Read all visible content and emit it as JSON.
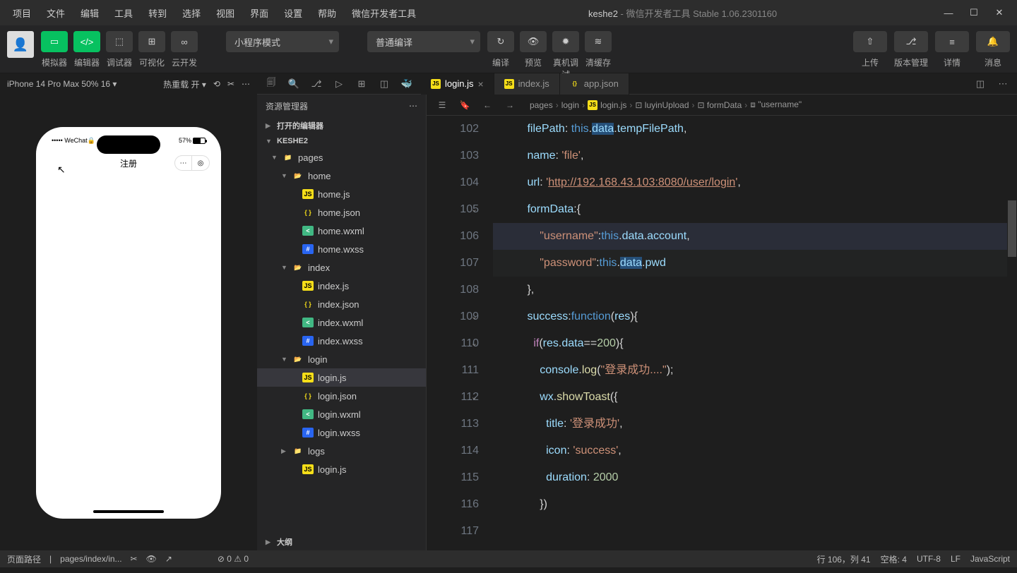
{
  "menu": [
    "项目",
    "文件",
    "编辑",
    "工具",
    "转到",
    "选择",
    "视图",
    "界面",
    "设置",
    "帮助",
    "微信开发者工具"
  ],
  "title": {
    "project": "keshe2",
    "suffix": " - 微信开发者工具 Stable 1.06.2301160"
  },
  "toolbar": {
    "labels": [
      "模拟器",
      "编辑器",
      "调试器",
      "可视化",
      "云开发"
    ],
    "mode": "小程序模式",
    "compile": "普通编译",
    "compile_labels": [
      "编译",
      "预览",
      "真机调试",
      "清缓存"
    ],
    "right": [
      "上传",
      "版本管理",
      "详情",
      "消息"
    ]
  },
  "simbar": {
    "device": "iPhone 14 Pro Max 50% 16 ▾",
    "reload": "热重载 开 ▾"
  },
  "phone": {
    "carrier": "••••• WeChat🔒",
    "batt": "57%",
    "title": "注册"
  },
  "explorer": {
    "title": "资源管理器",
    "sections": {
      "open": "打开的编辑器",
      "project": "KESHE2",
      "outline": "大纲"
    },
    "pages": "pages",
    "folders": {
      "home": "home",
      "index": "index",
      "login": "login",
      "logs": "logs"
    },
    "files": {
      "home": [
        "home.js",
        "home.json",
        "home.wxml",
        "home.wxss"
      ],
      "index": [
        "index.js",
        "index.json",
        "index.wxml",
        "index.wxss"
      ],
      "login": [
        "login.js",
        "login.json",
        "login.wxml",
        "login.wxss"
      ],
      "logs": [
        "login.js"
      ]
    }
  },
  "tabs": [
    {
      "name": "login.js",
      "active": true
    },
    {
      "name": "index.js"
    },
    {
      "name": "app.json"
    }
  ],
  "breadcrumbs": [
    "pages",
    "login",
    "login.js",
    "luyinUpload",
    "formData",
    "\"username\""
  ],
  "code": {
    "start": 102,
    "lines": [
      {
        "n": 102,
        "html": "          <span class='c-prop'>filePath</span><span class='c-pun'>:</span> <span class='c-this'>this</span><span class='c-pun'>.</span><span class='c-var sel'>data</span><span class='c-pun'>.</span><span class='c-var'>tempFilePath</span><span class='c-pun'>,</span>"
      },
      {
        "n": 103,
        "html": "          <span class='c-prop'>name</span><span class='c-pun'>:</span> <span class='c-str'>'file'</span><span class='c-pun'>,</span>"
      },
      {
        "n": 104,
        "html": "          <span class='c-prop'>url</span><span class='c-pun'>:</span> <span class='c-str'>'</span><span class='c-url'>http://192.168.43.103:8080/user/login</span><span class='c-str'>'</span><span class='c-pun'>,</span>"
      },
      {
        "n": 105,
        "fold": true,
        "html": "          <span class='c-prop'>formData</span><span class='c-pun'>:</span><span class='c-pun'>{</span>"
      },
      {
        "n": 106,
        "cur": true,
        "hl": true,
        "html": "              <span class='c-str'>\"username\"</span><span class='c-pun'>:</span><span class='c-this'>this</span><span class='c-pun'>.</span><span class='c-var'>data</span><span class='c-pun'>.</span><span class='c-var'>account</span><span class='c-pun'>,</span>"
      },
      {
        "n": 107,
        "hl": true,
        "html": "              <span class='c-str'>\"password\"</span><span class='c-pun'>:</span><span class='c-this'>this</span><span class='c-pun'>.</span><span class='c-var sel'>data</span><span class='c-pun'>.</span><span class='c-var'>pwd</span>"
      },
      {
        "n": 108,
        "html": "          <span class='c-pun'>},</span>"
      },
      {
        "n": 109,
        "fold": true,
        "html": "          <span class='c-prop'>success</span><span class='c-pun'>:</span><span class='c-this'>function</span><span class='c-pun'>(</span><span class='c-var'>res</span><span class='c-pun'>){</span>"
      },
      {
        "n": 110,
        "fold": true,
        "html": "            <span class='c-key'>if</span><span class='c-pun'>(</span><span class='c-var'>res</span><span class='c-pun'>.</span><span class='c-var'>data</span><span class='c-pun'>==</span><span class='c-num'>200</span><span class='c-pun'>){</span>"
      },
      {
        "n": 111,
        "html": "              <span class='c-var'>console</span><span class='c-pun'>.</span><span class='c-fn'>log</span><span class='c-pun'>(</span><span class='c-str'>\"登录成功....\"</span><span class='c-pun'>);</span>"
      },
      {
        "n": 112,
        "fold": true,
        "html": "              <span class='c-var'>wx</span><span class='c-pun'>.</span><span class='c-fn'>showToast</span><span class='c-pun'>({</span>"
      },
      {
        "n": 113,
        "html": "                <span class='c-prop'>title</span><span class='c-pun'>:</span> <span class='c-str'>'登录成功'</span><span class='c-pun'>,</span>"
      },
      {
        "n": 114,
        "html": "                <span class='c-prop'>icon</span><span class='c-pun'>:</span> <span class='c-str'>'success'</span><span class='c-pun'>,</span>"
      },
      {
        "n": 115,
        "html": "                <span class='c-prop'>duration</span><span class='c-pun'>:</span> <span class='c-num'>2000</span>"
      },
      {
        "n": 116,
        "html": "              <span class='c-pun'>})</span>"
      },
      {
        "n": 117,
        "html": ""
      }
    ]
  },
  "status": {
    "left": {
      "path": "页面路径",
      "route": "pages/index/in..."
    },
    "diag": "⊘ 0 ⚠ 0",
    "right": {
      "pos": "行 106，列 41",
      "spaces": "空格: 4",
      "enc": "UTF-8",
      "eol": "LF",
      "lang": "JavaScript"
    }
  }
}
